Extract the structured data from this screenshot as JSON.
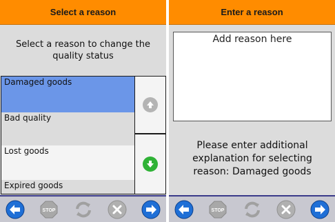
{
  "left": {
    "header": "Select a reason",
    "prompt_line1": "Select a reason to change the",
    "prompt_line2": "quality status",
    "reasons": [
      "Damaged goods",
      "Bad quality",
      "Lost goods",
      "Expired goods"
    ],
    "selected_index": 0,
    "scroll_up_icon": "arrow-up-icon",
    "scroll_down_icon": "arrow-down-icon"
  },
  "right": {
    "header": "Enter a reason",
    "placeholder": "Add reason here",
    "explain_line1": "Please enter additional",
    "explain_line2": "explanation for selecting",
    "explain_line3": "reason: Damaged goods"
  },
  "toolbar": {
    "buttons": [
      "back-icon",
      "stop-icon",
      "refresh-icon",
      "cancel-icon",
      "next-icon"
    ],
    "stop_label": "STOP"
  },
  "colors": {
    "header": "#ff8c00",
    "selected_row": "#6b96e8",
    "nav_blue": "#1f6fd6",
    "scroll_down_green": "#2fb236"
  }
}
